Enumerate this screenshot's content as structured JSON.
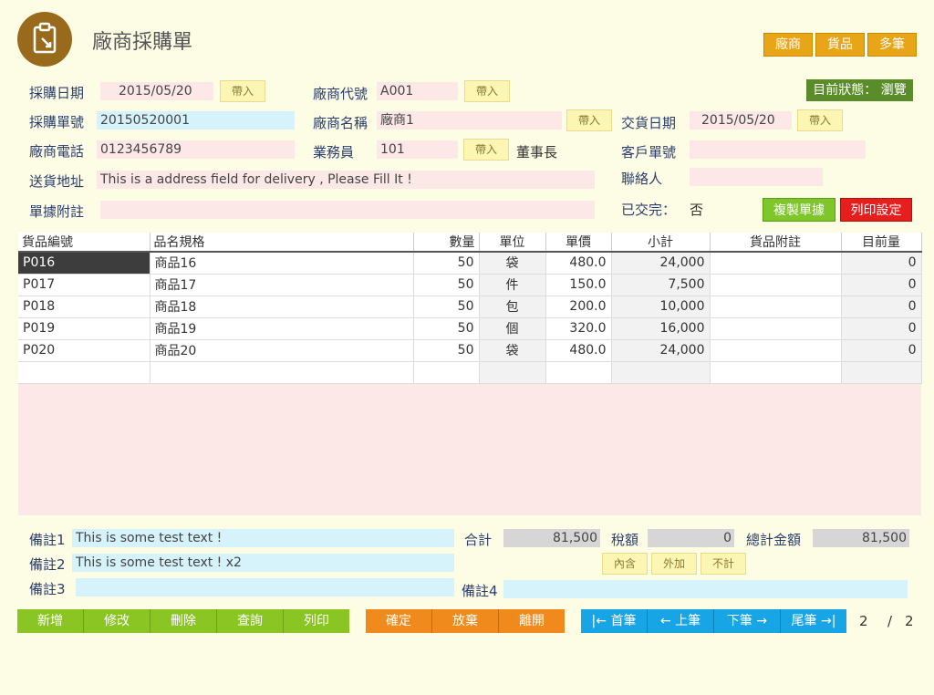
{
  "header": {
    "title": "廠商採購單",
    "top_buttons": [
      "廠商",
      "貨品",
      "多筆"
    ]
  },
  "status": {
    "label": "目前狀態： 瀏覽"
  },
  "form": {
    "purchase_date_label": "採購日期",
    "purchase_date": "2015/05/20",
    "order_no_label": "採購單號",
    "order_no": "20150520001",
    "vendor_phone_label": "廠商電話",
    "vendor_phone": "0123456789",
    "address_label": "送貨地址",
    "address": "This is a address field for delivery , Please Fill It !",
    "note_label": "單據附註",
    "note": "",
    "vendor_code_label": "廠商代號",
    "vendor_code": "A001",
    "vendor_name_label": "廠商名稱",
    "vendor_name": "廠商1",
    "salesman_label": "業務員",
    "salesman": "101",
    "salesman_title": "董事長",
    "contact_label": "聯絡人",
    "contact": "",
    "delivery_date_label": "交貨日期",
    "delivery_date": "2015/05/20",
    "customer_no_label": "客戶單號",
    "customer_no": "",
    "delivered_label": "已交完：",
    "delivered": "否",
    "import_label": "帶入"
  },
  "actions": {
    "copy": "複製單據",
    "print_settings": "列印設定"
  },
  "grid": {
    "columns": [
      "貨品編號",
      "品名規格",
      "數量",
      "單位",
      "單價",
      "小計",
      "貨品附註",
      "目前量"
    ],
    "rows": [
      [
        "P016",
        "商品16",
        "50",
        "袋",
        "480.0",
        "24,000",
        "",
        "0"
      ],
      [
        "P017",
        "商品17",
        "50",
        "件",
        "150.0",
        "7,500",
        "",
        "0"
      ],
      [
        "P018",
        "商品18",
        "50",
        "包",
        "200.0",
        "10,000",
        "",
        "0"
      ],
      [
        "P019",
        "商品19",
        "50",
        "個",
        "320.0",
        "16,000",
        "",
        "0"
      ],
      [
        "P020",
        "商品20",
        "50",
        "袋",
        "480.0",
        "24,000",
        "",
        "0"
      ]
    ]
  },
  "remarks": {
    "r1_label": "備註1",
    "r1": "This is some test text !",
    "r2_label": "備註2",
    "r2": "This is some test text ! x2",
    "r3_label": "備註3",
    "r3": "",
    "r4_label": "備註4",
    "r4": ""
  },
  "totals": {
    "subtotal_label": "合計",
    "subtotal": "81,500",
    "tax_label": "稅額",
    "tax": "0",
    "total_label": "總計金額",
    "total": "81,500",
    "tax_options": [
      "內含",
      "外加",
      "不計"
    ]
  },
  "bottom": {
    "edit_buttons": [
      "新增",
      "修改",
      "刪除",
      "查詢",
      "列印"
    ],
    "confirm_buttons": [
      "確定",
      "放棄",
      "離開"
    ],
    "nav_buttons": [
      "|← 首筆",
      "← 上筆",
      "下筆 →",
      "尾筆 →|"
    ],
    "page_current": "2",
    "page_sep": "/",
    "page_total": "2"
  }
}
